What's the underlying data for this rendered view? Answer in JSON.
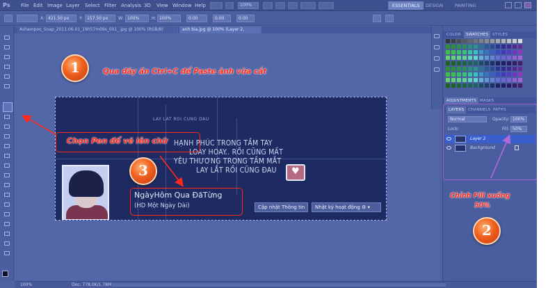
{
  "app": {
    "logo": "Ps"
  },
  "menu": [
    "File",
    "Edit",
    "Image",
    "Layer",
    "Select",
    "Filter",
    "Analysis",
    "3D",
    "View",
    "Window",
    "Help"
  ],
  "workspaces": {
    "essentials": "ESSENTIALS",
    "design": "DESIGN",
    "painting": "PAINTING"
  },
  "options": {
    "zoom1": "100%",
    "zoom2": "100%",
    "w": "421.50 px",
    "h": "157.50 px",
    "angle": "0.00",
    "h_skew": "0.00",
    "v_skew": "0.00"
  },
  "tabs": {
    "doc1": "Ashampoo_Snap_2011.06.01_19h57m09s_001_.jpg @ 100% (RGB/8)",
    "doc2": "anh bia.jpg @ 100% (Layer 2, RGB/8)"
  },
  "canvas": {
    "poem_top": "LAY LAT ROI CUNG DAU",
    "poem_lines": [
      "HẠNH PHÚC TRONG TẦM TAY",
      "LOAY HOAY.. RỒI CŨNG MẤT",
      "YÊU THƯƠNG TRONG TẦM MẮT",
      "LAY LẮT RỒI CŨNG ĐAU"
    ],
    "name_title": "NgàyHôm Qua ĐãTừng",
    "name_sub": "(HD Một Ngày Dài)",
    "btn_update": "Cập nhật Thông tin",
    "btn_activity": "Nhật ký hoạt động"
  },
  "status": {
    "zoom": "100%",
    "doc": "Doc: 778.0K/1.78M"
  },
  "panels": {
    "swatch_tabs": [
      "COLOR",
      "SWATCHES",
      "STYLES"
    ],
    "adjust_tabs": [
      "ADJUSTMENTS",
      "MASKS"
    ],
    "layer_tabs": [
      "LAYERS",
      "CHANNELS",
      "PATHS"
    ],
    "blend_mode": "Normal",
    "opacity_label": "Opacity:",
    "opacity": "100%",
    "lock_label": "Lock:",
    "fill_label": "Fill:",
    "fill": "50%",
    "layers": [
      "Layer 2",
      "Background"
    ]
  },
  "annotations": {
    "step1_num": "1",
    "step1": "Qua đây ấn Ctrl+C để Paste ảnh vừa cắt",
    "step2_num": "2",
    "step2_line1": "Chỉnh Fill xuống",
    "step2_line2": "50%",
    "step3_num": "3",
    "pen": "Chọn Pen để vẽ lên chữ"
  },
  "colors": {
    "annotation": "#ff2a1c",
    "circle": "#f0601e",
    "selected_layer": "#3a5fcc"
  }
}
